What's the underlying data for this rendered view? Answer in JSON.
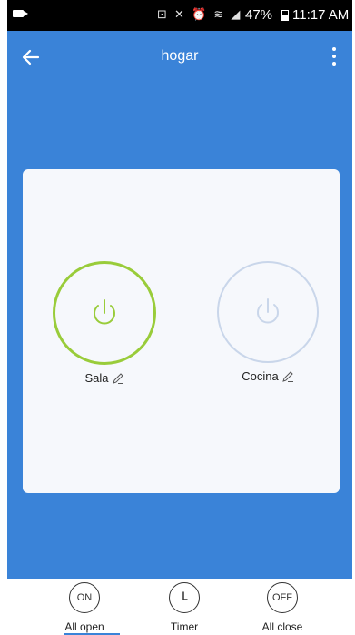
{
  "status_bar": {
    "indicators": "⊡ ✕ ⏰ ≋ ◢",
    "battery": "47%",
    "time": "11:17 AM"
  },
  "header": {
    "title": "hogar",
    "back_icon": "arrow-left-icon",
    "menu_icon": "more-vertical-icon"
  },
  "devices": [
    {
      "name": "Sala",
      "state": "on",
      "ring_color": "#99cc3a",
      "icon_color": "#99cc3a"
    },
    {
      "name": "Cocina",
      "state": "off",
      "ring_color": "#c9d6ea",
      "icon_color": "#c9d6ea"
    }
  ],
  "bottom_bar": {
    "all_open": {
      "icon_text": "ON",
      "label": "All open"
    },
    "timer": {
      "icon": "clock-icon",
      "label": "Timer"
    },
    "all_close": {
      "icon_text": "OFF",
      "label": "All close"
    }
  },
  "colors": {
    "header_bg": "#3a83d8",
    "card_bg": "#f6f8fc",
    "on_accent": "#99cc3a",
    "off_accent": "#c9d6ea"
  }
}
